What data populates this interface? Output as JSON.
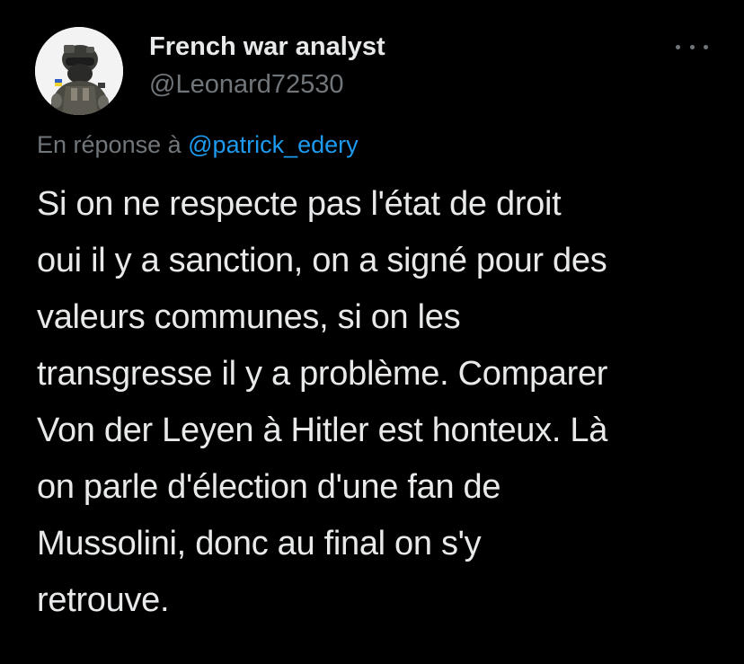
{
  "tweet": {
    "author": {
      "display_name": "French war analyst",
      "handle": "@Leonard72530"
    },
    "more_icon": "more-horizontal-icon",
    "reply": {
      "prefix": "En réponse à",
      "mention": "@patrick_edery"
    },
    "body_lines": [
      "Si on ne respecte pas l'état de droit",
      "oui il y a sanction, on a signé pour des",
      "valeurs communes, si on les",
      "transgresse il y a problème. Comparer",
      "Von der Leyen à Hitler est honteux. Là",
      "on parle d'élection d'une fan de",
      "Mussolini, donc au final on s'y",
      "retrouve."
    ]
  },
  "colors": {
    "background": "#000000",
    "primary_text": "#e7e9ea",
    "secondary_text": "#71767b",
    "link": "#1d9bf0"
  }
}
